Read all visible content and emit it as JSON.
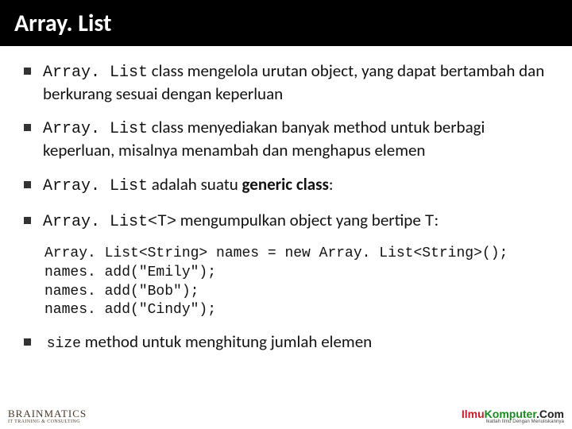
{
  "title": "Array. List",
  "bullets": [
    {
      "code": "Array. List",
      "text": " class mengelola urutan object, yang dapat bertambah dan berkurang sesuai dengan keperluan"
    },
    {
      "code": "Array. List",
      "text": " class menyediakan banyak method untuk berbagi keperluan, misalnya menambah dan menghapus elemen"
    },
    {
      "code": "Array. List",
      "text_before": " adalah suatu ",
      "bold": "generic class",
      "text_after": ":"
    },
    {
      "code": "Array. List<T>",
      "text_before": " mengumpulkan object yang bertipe ",
      "code2": "T",
      "text_after": ":"
    }
  ],
  "code_block": "Array. List<String> names = new Array. List<String>();\nnames. add(\"Emily\");\nnames. add(\"Bob\");\nnames. add(\"Cindy\");",
  "last_bullet": {
    "code": "size",
    "text": " method untuk menghitung jumlah elemen"
  },
  "footer": {
    "left_big": "BRAINMATICS",
    "left_small": "IT TRAINING & CONSULTING",
    "right_ilmu": "Ilmu",
    "right_komp": "Komputer",
    "right_com": ".Com",
    "right_tag": "Ikatlah Ilmu Dengan Menuliskannya"
  }
}
